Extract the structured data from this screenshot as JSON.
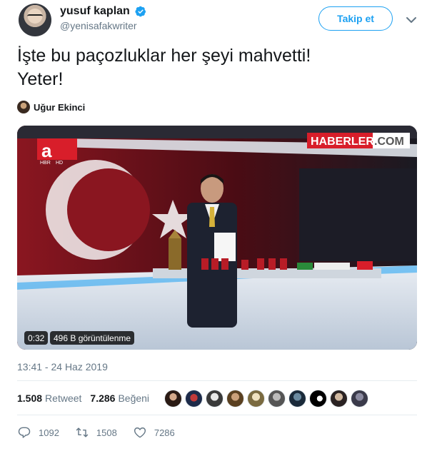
{
  "author": {
    "name": "yusuf kaplan",
    "handle": "@yenisafakwriter",
    "follow_label": "Takip et"
  },
  "tweet": {
    "text_line1": "İşte bu paçozluklar her şeyi mahvetti!",
    "text_line2": "Yeter!"
  },
  "quoted_user": {
    "name": "Uğur Ekinci"
  },
  "video": {
    "duration": "0:32",
    "views": "496 B görüntülenme",
    "watermark": "HABERLER",
    "watermark_suffix": ".COM",
    "channel_logo": "a",
    "channel_sub": "HBR",
    "channel_hd": "HD"
  },
  "timestamp": "13:41 - 24 Haz 2019",
  "stats": {
    "retweets": "1.508",
    "retweets_label": "Retweet",
    "likes": "7.286",
    "likes_label": "Beğeni"
  },
  "actions": {
    "replies": "1092",
    "retweets": "1508",
    "likes": "7286"
  },
  "colors": {
    "brand_blue": "#1da1f2",
    "secondary_text": "#657786",
    "flag_red": "#d81e2a",
    "studio_red": "#7a0e18"
  },
  "likers_count": 10
}
